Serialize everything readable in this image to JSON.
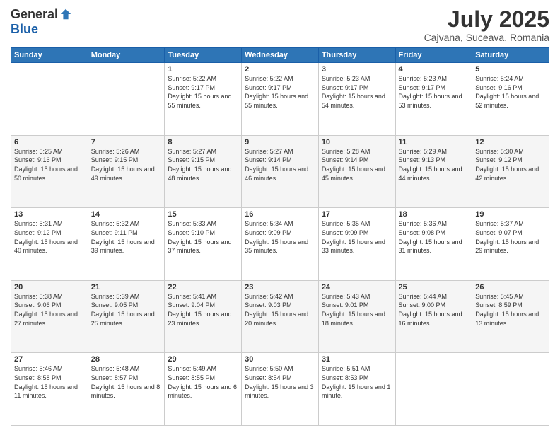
{
  "header": {
    "logo_general": "General",
    "logo_blue": "Blue",
    "month_title": "July 2025",
    "location": "Cajvana, Suceava, Romania"
  },
  "days_of_week": [
    "Sunday",
    "Monday",
    "Tuesday",
    "Wednesday",
    "Thursday",
    "Friday",
    "Saturday"
  ],
  "weeks": [
    [
      {
        "day": "",
        "sunrise": "",
        "sunset": "",
        "daylight": ""
      },
      {
        "day": "",
        "sunrise": "",
        "sunset": "",
        "daylight": ""
      },
      {
        "day": "1",
        "sunrise": "Sunrise: 5:22 AM",
        "sunset": "Sunset: 9:17 PM",
        "daylight": "Daylight: 15 hours and 55 minutes."
      },
      {
        "day": "2",
        "sunrise": "Sunrise: 5:22 AM",
        "sunset": "Sunset: 9:17 PM",
        "daylight": "Daylight: 15 hours and 55 minutes."
      },
      {
        "day": "3",
        "sunrise": "Sunrise: 5:23 AM",
        "sunset": "Sunset: 9:17 PM",
        "daylight": "Daylight: 15 hours and 54 minutes."
      },
      {
        "day": "4",
        "sunrise": "Sunrise: 5:23 AM",
        "sunset": "Sunset: 9:17 PM",
        "daylight": "Daylight: 15 hours and 53 minutes."
      },
      {
        "day": "5",
        "sunrise": "Sunrise: 5:24 AM",
        "sunset": "Sunset: 9:16 PM",
        "daylight": "Daylight: 15 hours and 52 minutes."
      }
    ],
    [
      {
        "day": "6",
        "sunrise": "Sunrise: 5:25 AM",
        "sunset": "Sunset: 9:16 PM",
        "daylight": "Daylight: 15 hours and 50 minutes."
      },
      {
        "day": "7",
        "sunrise": "Sunrise: 5:26 AM",
        "sunset": "Sunset: 9:15 PM",
        "daylight": "Daylight: 15 hours and 49 minutes."
      },
      {
        "day": "8",
        "sunrise": "Sunrise: 5:27 AM",
        "sunset": "Sunset: 9:15 PM",
        "daylight": "Daylight: 15 hours and 48 minutes."
      },
      {
        "day": "9",
        "sunrise": "Sunrise: 5:27 AM",
        "sunset": "Sunset: 9:14 PM",
        "daylight": "Daylight: 15 hours and 46 minutes."
      },
      {
        "day": "10",
        "sunrise": "Sunrise: 5:28 AM",
        "sunset": "Sunset: 9:14 PM",
        "daylight": "Daylight: 15 hours and 45 minutes."
      },
      {
        "day": "11",
        "sunrise": "Sunrise: 5:29 AM",
        "sunset": "Sunset: 9:13 PM",
        "daylight": "Daylight: 15 hours and 44 minutes."
      },
      {
        "day": "12",
        "sunrise": "Sunrise: 5:30 AM",
        "sunset": "Sunset: 9:12 PM",
        "daylight": "Daylight: 15 hours and 42 minutes."
      }
    ],
    [
      {
        "day": "13",
        "sunrise": "Sunrise: 5:31 AM",
        "sunset": "Sunset: 9:12 PM",
        "daylight": "Daylight: 15 hours and 40 minutes."
      },
      {
        "day": "14",
        "sunrise": "Sunrise: 5:32 AM",
        "sunset": "Sunset: 9:11 PM",
        "daylight": "Daylight: 15 hours and 39 minutes."
      },
      {
        "day": "15",
        "sunrise": "Sunrise: 5:33 AM",
        "sunset": "Sunset: 9:10 PM",
        "daylight": "Daylight: 15 hours and 37 minutes."
      },
      {
        "day": "16",
        "sunrise": "Sunrise: 5:34 AM",
        "sunset": "Sunset: 9:09 PM",
        "daylight": "Daylight: 15 hours and 35 minutes."
      },
      {
        "day": "17",
        "sunrise": "Sunrise: 5:35 AM",
        "sunset": "Sunset: 9:09 PM",
        "daylight": "Daylight: 15 hours and 33 minutes."
      },
      {
        "day": "18",
        "sunrise": "Sunrise: 5:36 AM",
        "sunset": "Sunset: 9:08 PM",
        "daylight": "Daylight: 15 hours and 31 minutes."
      },
      {
        "day": "19",
        "sunrise": "Sunrise: 5:37 AM",
        "sunset": "Sunset: 9:07 PM",
        "daylight": "Daylight: 15 hours and 29 minutes."
      }
    ],
    [
      {
        "day": "20",
        "sunrise": "Sunrise: 5:38 AM",
        "sunset": "Sunset: 9:06 PM",
        "daylight": "Daylight: 15 hours and 27 minutes."
      },
      {
        "day": "21",
        "sunrise": "Sunrise: 5:39 AM",
        "sunset": "Sunset: 9:05 PM",
        "daylight": "Daylight: 15 hours and 25 minutes."
      },
      {
        "day": "22",
        "sunrise": "Sunrise: 5:41 AM",
        "sunset": "Sunset: 9:04 PM",
        "daylight": "Daylight: 15 hours and 23 minutes."
      },
      {
        "day": "23",
        "sunrise": "Sunrise: 5:42 AM",
        "sunset": "Sunset: 9:03 PM",
        "daylight": "Daylight: 15 hours and 20 minutes."
      },
      {
        "day": "24",
        "sunrise": "Sunrise: 5:43 AM",
        "sunset": "Sunset: 9:01 PM",
        "daylight": "Daylight: 15 hours and 18 minutes."
      },
      {
        "day": "25",
        "sunrise": "Sunrise: 5:44 AM",
        "sunset": "Sunset: 9:00 PM",
        "daylight": "Daylight: 15 hours and 16 minutes."
      },
      {
        "day": "26",
        "sunrise": "Sunrise: 5:45 AM",
        "sunset": "Sunset: 8:59 PM",
        "daylight": "Daylight: 15 hours and 13 minutes."
      }
    ],
    [
      {
        "day": "27",
        "sunrise": "Sunrise: 5:46 AM",
        "sunset": "Sunset: 8:58 PM",
        "daylight": "Daylight: 15 hours and 11 minutes."
      },
      {
        "day": "28",
        "sunrise": "Sunrise: 5:48 AM",
        "sunset": "Sunset: 8:57 PM",
        "daylight": "Daylight: 15 hours and 8 minutes."
      },
      {
        "day": "29",
        "sunrise": "Sunrise: 5:49 AM",
        "sunset": "Sunset: 8:55 PM",
        "daylight": "Daylight: 15 hours and 6 minutes."
      },
      {
        "day": "30",
        "sunrise": "Sunrise: 5:50 AM",
        "sunset": "Sunset: 8:54 PM",
        "daylight": "Daylight: 15 hours and 3 minutes."
      },
      {
        "day": "31",
        "sunrise": "Sunrise: 5:51 AM",
        "sunset": "Sunset: 8:53 PM",
        "daylight": "Daylight: 15 hours and 1 minute."
      },
      {
        "day": "",
        "sunrise": "",
        "sunset": "",
        "daylight": ""
      },
      {
        "day": "",
        "sunrise": "",
        "sunset": "",
        "daylight": ""
      }
    ]
  ]
}
